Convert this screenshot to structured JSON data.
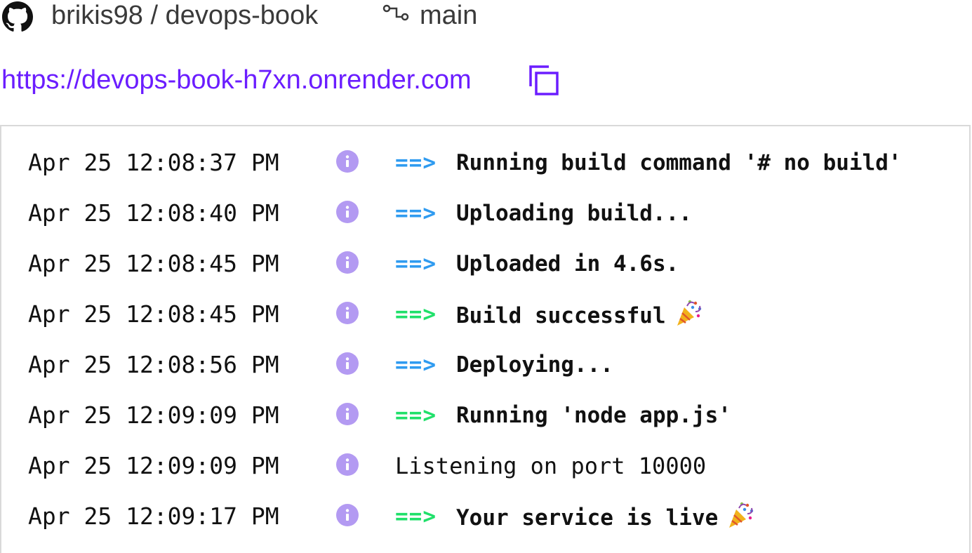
{
  "header": {
    "repo": "brikis98 / devops-book",
    "branch": "main",
    "icons": {
      "repo": "github-icon",
      "branch": "git-branch-icon"
    }
  },
  "service": {
    "url": "https://devops-book-h7xn.onrender.com",
    "copy_icon": "copy-icon"
  },
  "colors": {
    "url": "#6b1dff",
    "arrow_blue": "#2f9bf0",
    "arrow_green": "#1fe06a",
    "info_icon": "#b39af2"
  },
  "logs": [
    {
      "time": "Apr 25 12:08:37 PM",
      "arrow": "==>",
      "arrow_color": "blue",
      "message": "Running build command '# no build'",
      "emoji": ""
    },
    {
      "time": "Apr 25 12:08:40 PM",
      "arrow": "==>",
      "arrow_color": "blue",
      "message": "Uploading build...",
      "emoji": ""
    },
    {
      "time": "Apr 25 12:08:45 PM",
      "arrow": "==>",
      "arrow_color": "blue",
      "message": "Uploaded in 4.6s.",
      "emoji": ""
    },
    {
      "time": "Apr 25 12:08:45 PM",
      "arrow": "==>",
      "arrow_color": "green",
      "message": "Build successful",
      "emoji": "party-popper"
    },
    {
      "time": "Apr 25 12:08:56 PM",
      "arrow": "==>",
      "arrow_color": "blue",
      "message": "Deploying...",
      "emoji": ""
    },
    {
      "time": "Apr 25 12:09:09 PM",
      "arrow": "==>",
      "arrow_color": "green",
      "message": "Running 'node app.js'",
      "emoji": ""
    },
    {
      "time": "Apr 25 12:09:09 PM",
      "arrow": "",
      "arrow_color": "",
      "message": "Listening on port 10000",
      "emoji": ""
    },
    {
      "time": "Apr 25 12:09:17 PM",
      "arrow": "==>",
      "arrow_color": "green",
      "message": "Your service is live",
      "emoji": "party-popper"
    }
  ]
}
